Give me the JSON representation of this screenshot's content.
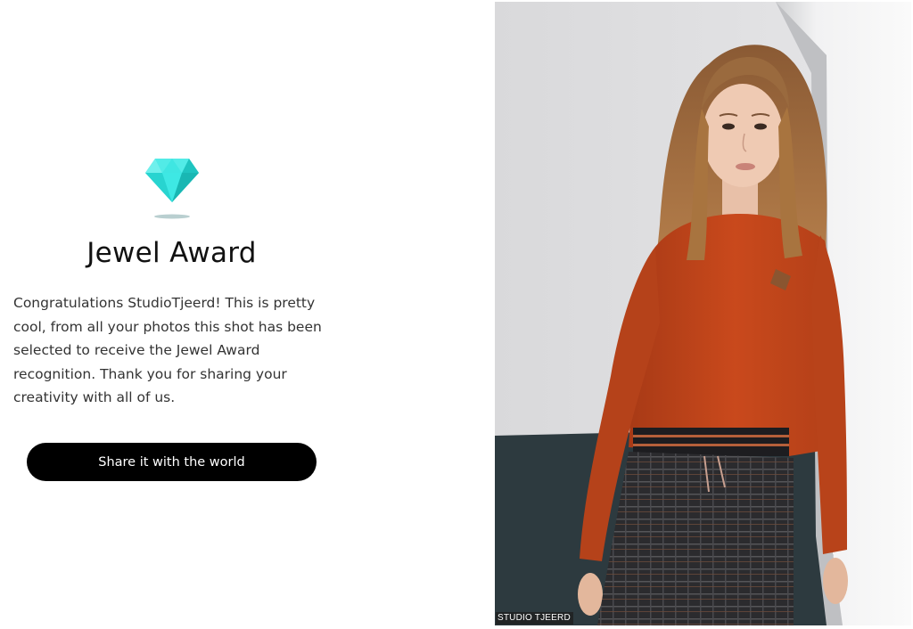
{
  "award": {
    "icon": "diamond-icon",
    "title": "Jewel Award",
    "message": "Congratulations StudioTjeerd! This is pretty cool, from all your photos this shot has been selected to receive the Jewel Award recognition. Thank you for sharing your creativity with all of us.",
    "share_label": "Share it with the world"
  },
  "photo": {
    "watermark": "STUDIO TJEERD"
  },
  "colors": {
    "diamond": "#2fe0dc",
    "button_bg": "#000000",
    "button_text": "#ffffff",
    "shirt": "#c2461c"
  }
}
